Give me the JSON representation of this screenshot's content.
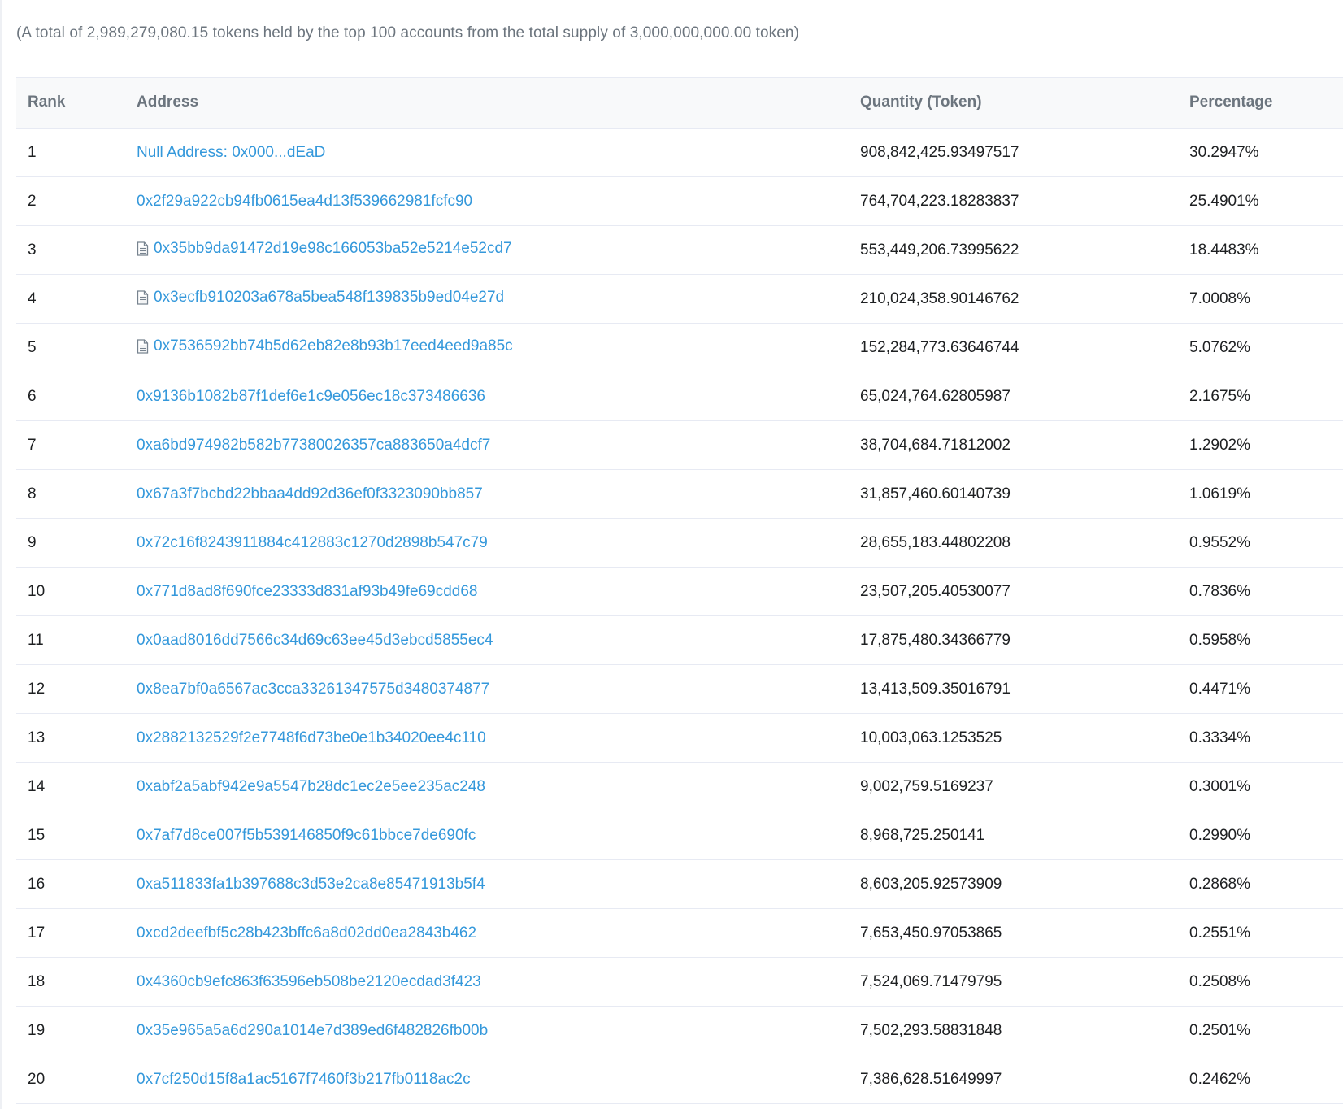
{
  "summary": "(A total of 2,989,279,080.15 tokens held by the top 100 accounts from the total supply of 3,000,000,000.00 token)",
  "table": {
    "headers": {
      "rank": "Rank",
      "address": "Address",
      "quantity": "Quantity (Token)",
      "percentage": "Percentage"
    },
    "link_color": "#3498db",
    "rows": [
      {
        "rank": "1",
        "address": "Null Address: 0x000...dEaD",
        "contract": false,
        "quantity": "908,842,425.93497517",
        "percentage": "30.2947%"
      },
      {
        "rank": "2",
        "address": "0x2f29a922cb94fb0615ea4d13f539662981fcfc90",
        "contract": false,
        "quantity": "764,704,223.18283837",
        "percentage": "25.4901%"
      },
      {
        "rank": "3",
        "address": "0x35bb9da91472d19e98c166053ba52e5214e52cd7",
        "contract": true,
        "quantity": "553,449,206.73995622",
        "percentage": "18.4483%"
      },
      {
        "rank": "4",
        "address": "0x3ecfb910203a678a5bea548f139835b9ed04e27d",
        "contract": true,
        "quantity": "210,024,358.90146762",
        "percentage": "7.0008%"
      },
      {
        "rank": "5",
        "address": "0x7536592bb74b5d62eb82e8b93b17eed4eed9a85c",
        "contract": true,
        "quantity": "152,284,773.63646744",
        "percentage": "5.0762%"
      },
      {
        "rank": "6",
        "address": "0x9136b1082b87f1def6e1c9e056ec18c373486636",
        "contract": false,
        "quantity": "65,024,764.62805987",
        "percentage": "2.1675%"
      },
      {
        "rank": "7",
        "address": "0xa6bd974982b582b77380026357ca883650a4dcf7",
        "contract": false,
        "quantity": "38,704,684.71812002",
        "percentage": "1.2902%"
      },
      {
        "rank": "8",
        "address": "0x67a3f7bcbd22bbaa4dd92d36ef0f3323090bb857",
        "contract": false,
        "quantity": "31,857,460.60140739",
        "percentage": "1.0619%"
      },
      {
        "rank": "9",
        "address": "0x72c16f8243911884c412883c1270d2898b547c79",
        "contract": false,
        "quantity": "28,655,183.44802208",
        "percentage": "0.9552%"
      },
      {
        "rank": "10",
        "address": "0x771d8ad8f690fce23333d831af93b49fe69cdd68",
        "contract": false,
        "quantity": "23,507,205.40530077",
        "percentage": "0.7836%"
      },
      {
        "rank": "11",
        "address": "0x0aad8016dd7566c34d69c63ee45d3ebcd5855ec4",
        "contract": false,
        "quantity": "17,875,480.34366779",
        "percentage": "0.5958%"
      },
      {
        "rank": "12",
        "address": "0x8ea7bf0a6567ac3cca33261347575d3480374877",
        "contract": false,
        "quantity": "13,413,509.35016791",
        "percentage": "0.4471%"
      },
      {
        "rank": "13",
        "address": "0x2882132529f2e7748f6d73be0e1b34020ee4c110",
        "contract": false,
        "quantity": "10,003,063.1253525",
        "percentage": "0.3334%"
      },
      {
        "rank": "14",
        "address": "0xabf2a5abf942e9a5547b28dc1ec2e5ee235ac248",
        "contract": false,
        "quantity": "9,002,759.5169237",
        "percentage": "0.3001%"
      },
      {
        "rank": "15",
        "address": "0x7af7d8ce007f5b539146850f9c61bbce7de690fc",
        "contract": false,
        "quantity": "8,968,725.250141",
        "percentage": "0.2990%"
      },
      {
        "rank": "16",
        "address": "0xa511833fa1b397688c3d53e2ca8e85471913b5f4",
        "contract": false,
        "quantity": "8,603,205.92573909",
        "percentage": "0.2868%"
      },
      {
        "rank": "17",
        "address": "0xcd2deefbf5c28b423bffc6a8d02dd0ea2843b462",
        "contract": false,
        "quantity": "7,653,450.97053865",
        "percentage": "0.2551%"
      },
      {
        "rank": "18",
        "address": "0x4360cb9efc863f63596eb508be2120ecdad3f423",
        "contract": false,
        "quantity": "7,524,069.71479795",
        "percentage": "0.2508%"
      },
      {
        "rank": "19",
        "address": "0x35e965a5a6d290a1014e7d389ed6f482826fb00b",
        "contract": false,
        "quantity": "7,502,293.58831848",
        "percentage": "0.2501%"
      },
      {
        "rank": "20",
        "address": "0x7cf250d15f8a1ac5167f7460f3b217fb0118ac2c",
        "contract": false,
        "quantity": "7,386,628.51649997",
        "percentage": "0.2462%"
      }
    ]
  }
}
